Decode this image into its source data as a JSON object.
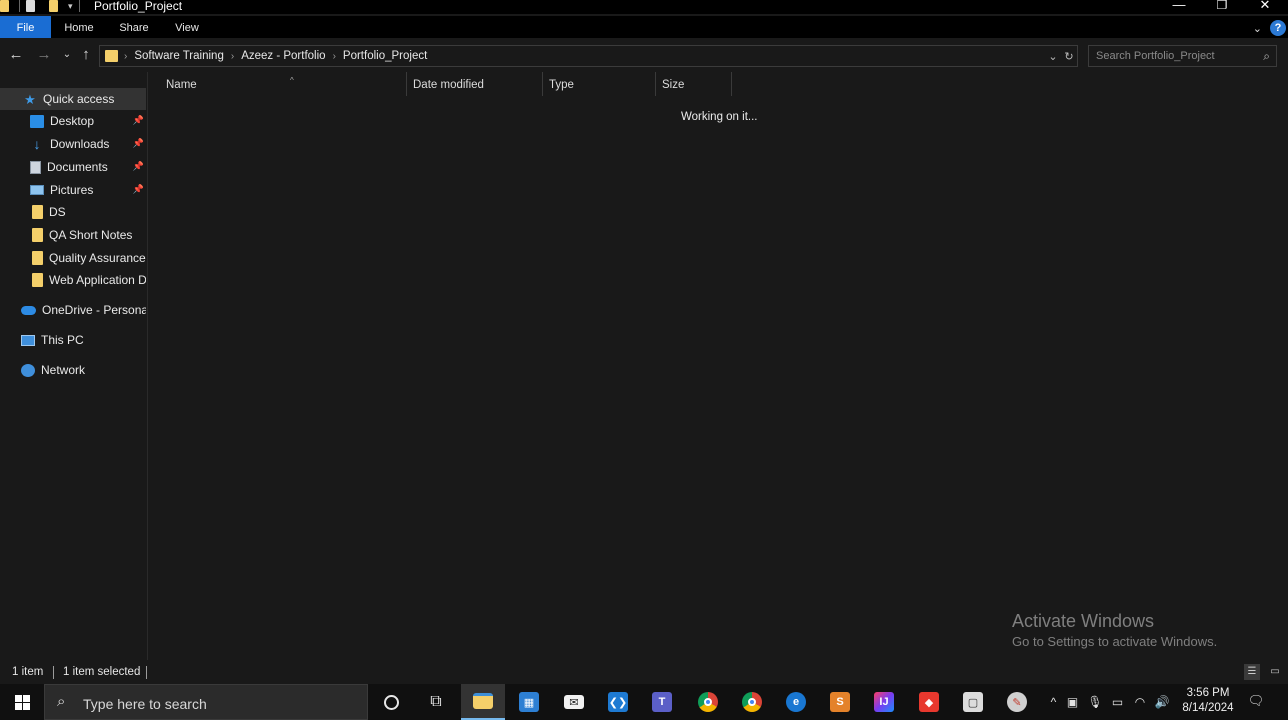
{
  "window": {
    "title": "Portfolio_Project",
    "controls": {
      "minimize": "—",
      "restore": "❐",
      "close": "✕"
    }
  },
  "ribbon": {
    "tabs": [
      "File",
      "Home",
      "Share",
      "View"
    ],
    "expand_icon": "chevron-down-icon",
    "help_label": "?"
  },
  "address": {
    "crumbs": [
      "Software Training",
      "Azeez - Portfolio",
      "Portfolio_Project"
    ],
    "search_placeholder": "Search Portfolio_Project"
  },
  "nav_pane": {
    "quick_access": "Quick access",
    "pinned": [
      {
        "label": "Desktop",
        "icon": "desktop-icon"
      },
      {
        "label": "Downloads",
        "icon": "download-arrow-icon"
      },
      {
        "label": "Documents",
        "icon": "document-icon"
      },
      {
        "label": "Pictures",
        "icon": "pictures-icon"
      }
    ],
    "folders": [
      "DS",
      "QA Short Notes",
      "Quality Assurance",
      "Web Application DS"
    ],
    "onedrive": "OneDrive - Personal",
    "this_pc": "This PC",
    "network": "Network"
  },
  "columns": [
    "Name",
    "Date modified",
    "Type",
    "Size"
  ],
  "content": {
    "status_message": "Working on it..."
  },
  "watermark": {
    "line1": "Activate Windows",
    "line2": "Go to Settings to activate Windows."
  },
  "statusbar": {
    "item_count": "1 item",
    "selected": "1 item selected"
  },
  "taskbar": {
    "search_placeholder": "Type here to search",
    "apps": [
      {
        "name": "cortana",
        "icon": "cortana-circle-icon"
      },
      {
        "name": "task-view",
        "icon": "task-view-icon"
      },
      {
        "name": "file-explorer",
        "icon": "folder-icon",
        "active": true
      },
      {
        "name": "store",
        "icon": "store-bag-icon"
      },
      {
        "name": "mail",
        "icon": "mail-icon"
      },
      {
        "name": "vscode",
        "icon": "vscode-icon"
      },
      {
        "name": "teams",
        "icon": "teams-icon"
      },
      {
        "name": "chrome",
        "icon": "chrome-icon"
      },
      {
        "name": "chrome-2",
        "icon": "chrome-icon"
      },
      {
        "name": "edge",
        "icon": "edge-icon"
      },
      {
        "name": "sublime",
        "icon": "sublime-icon"
      },
      {
        "name": "intellij",
        "icon": "intellij-icon"
      },
      {
        "name": "anydesk",
        "icon": "anydesk-icon"
      },
      {
        "name": "screen-tool",
        "icon": "screen-tool-icon"
      },
      {
        "name": "app-misc",
        "icon": "app-icon"
      }
    ],
    "clock_time": "3:56 PM",
    "clock_date": "8/14/2024"
  },
  "colors": {
    "accent": "#1a6dd3",
    "background": "#191919",
    "folder": "#f4cf6a"
  }
}
